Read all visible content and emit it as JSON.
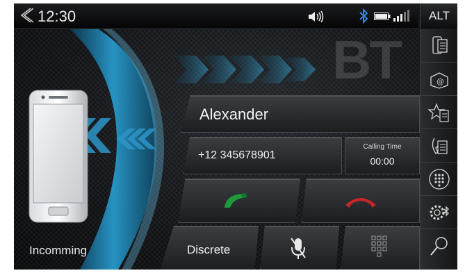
{
  "status_bar": {
    "time": "12:30",
    "alt_label": "ALT",
    "icons": [
      "back-chevron-icon",
      "volume-icon",
      "bluetooth-icon",
      "battery-icon",
      "signal-icon"
    ]
  },
  "watermark": "BT",
  "call": {
    "contact_name": "Alexander",
    "phone_number": "+12 345678901",
    "calling_time_label": "Calling Time",
    "calling_time_value": "00:00",
    "status": "Incomming"
  },
  "actions": {
    "discrete_label": "Discrete",
    "accept_color": "#1f9a3a",
    "reject_color": "#c8262b"
  },
  "side_menu": [
    "phone-contacts-icon",
    "address-book-icon",
    "favorites-icon",
    "call-log-icon",
    "dialpad-icon",
    "bluetooth-settings-icon",
    "search-icon"
  ],
  "colors": {
    "accent": "#2aa8e0",
    "background": "#0b0d10"
  }
}
